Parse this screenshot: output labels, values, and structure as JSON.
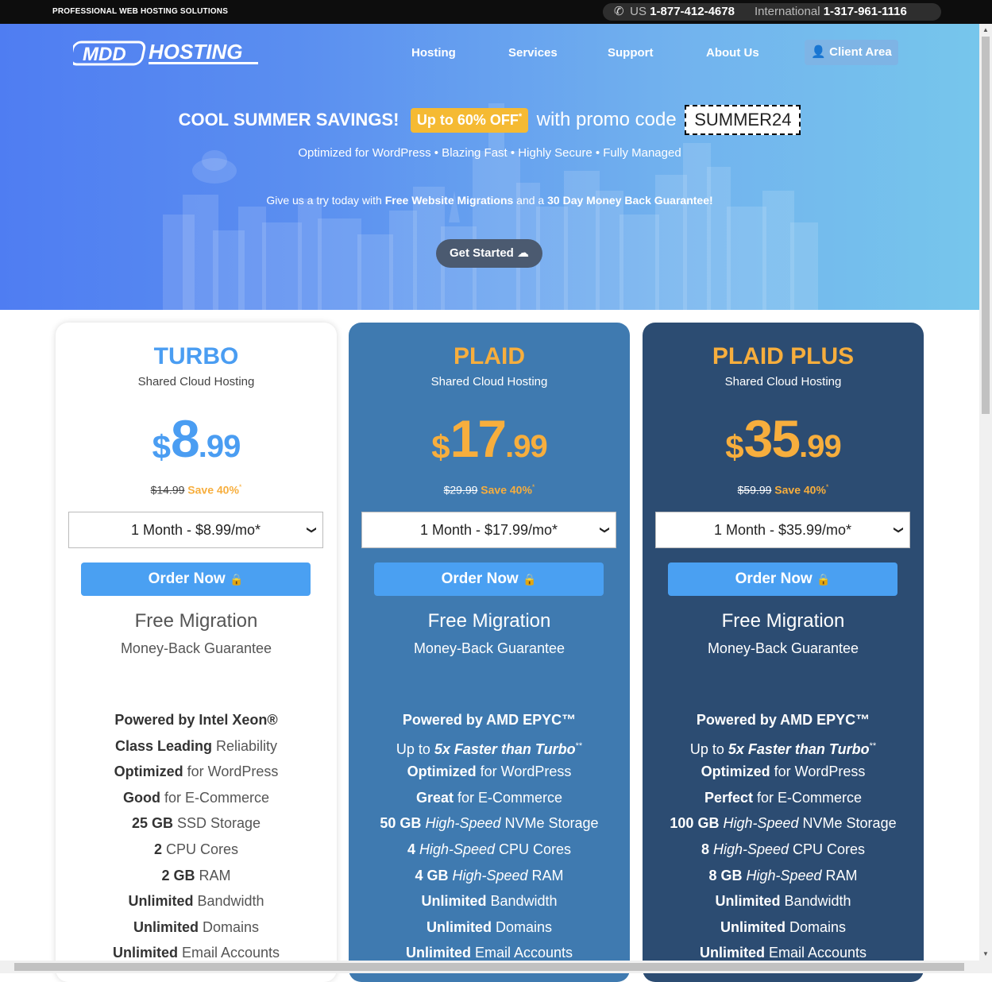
{
  "topbar": {
    "tagline": "PROFESSIONAL WEB HOSTING SOLUTIONS",
    "us_label": "US",
    "us_phone": "1-877-412-4678",
    "intl_label": "International",
    "intl_phone": "1-317-961-1116"
  },
  "nav": {
    "logo_text": "MDDHOSTING",
    "items": [
      "Hosting",
      "Services",
      "Support",
      "About Us"
    ],
    "client_area": "Client Area"
  },
  "hero": {
    "title": "COOL SUMMER SAVINGS!",
    "badge": "Up to 60% OFF",
    "badge_mark": "*",
    "with_promo": "with promo code",
    "promo_code": "SUMMER24",
    "subline": "Optimized for WordPress • Blazing Fast • Highly Secure • Fully Managed",
    "try_pre": "Give us a try today with ",
    "try_bold1": "Free Website Migrations",
    "try_mid": " and a ",
    "try_bold2": "30 Day Money Back Guarantee!",
    "cta": "Get Started"
  },
  "plans": [
    {
      "name": "TURBO",
      "type": "Shared Cloud Hosting",
      "currency": "$",
      "whole": "8",
      "cents": ".99",
      "old_price": "$14.99",
      "save": "Save 40%",
      "save_mark": "*",
      "term": "1 Month - $8.99/mo*",
      "order": "Order Now",
      "free_migration": "Free Migration",
      "money_back": "Money-Back Guarantee",
      "features": [
        {
          "bold": "Powered by Intel Xeon®",
          "italic": "",
          "rest": "",
          "sup": ""
        },
        {
          "bold": "Class Leading",
          "italic": "",
          "rest": " Reliability",
          "sup": ""
        },
        {
          "bold": "Optimized",
          "italic": "",
          "rest": " for WordPress",
          "sup": ""
        },
        {
          "bold": "Good",
          "italic": "",
          "rest": " for E-Commerce",
          "sup": ""
        },
        {
          "bold": "25 GB",
          "italic": "",
          "rest": " SSD Storage",
          "sup": ""
        },
        {
          "bold": "2",
          "italic": "",
          "rest": " CPU Cores",
          "sup": ""
        },
        {
          "bold": "2 GB",
          "italic": "",
          "rest": " RAM",
          "sup": ""
        },
        {
          "bold": "Unlimited",
          "italic": "",
          "rest": " Bandwidth",
          "sup": ""
        },
        {
          "bold": "Unlimited",
          "italic": "",
          "rest": " Domains",
          "sup": ""
        },
        {
          "bold": "Unlimited",
          "italic": "",
          "rest": " Email Accounts",
          "sup": ""
        }
      ]
    },
    {
      "name": "PLAID",
      "type": "Shared Cloud Hosting",
      "currency": "$",
      "whole": "17",
      "cents": ".99",
      "old_price": "$29.99",
      "save": "Save 40%",
      "save_mark": "*",
      "term": "1 Month - $17.99/mo*",
      "order": "Order Now",
      "free_migration": "Free Migration",
      "money_back": "Money-Back Guarantee",
      "features": [
        {
          "bold": "Powered by AMD EPYC™",
          "italic": "",
          "rest": "",
          "sup": ""
        },
        {
          "pre": "Up to ",
          "bold_italic": "5x Faster than Turbo",
          "sup": "**"
        },
        {
          "bold": "Optimized",
          "italic": "",
          "rest": " for WordPress",
          "sup": ""
        },
        {
          "bold": "Great",
          "italic": "",
          "rest": " for E-Commerce",
          "sup": ""
        },
        {
          "bold": "50 GB",
          "italic": " High-Speed",
          "rest": " NVMe Storage",
          "sup": ""
        },
        {
          "bold": "4",
          "italic": " High-Speed",
          "rest": " CPU Cores",
          "sup": ""
        },
        {
          "bold": "4 GB",
          "italic": " High-Speed",
          "rest": " RAM",
          "sup": ""
        },
        {
          "bold": "Unlimited",
          "italic": "",
          "rest": " Bandwidth",
          "sup": ""
        },
        {
          "bold": "Unlimited",
          "italic": "",
          "rest": " Domains",
          "sup": ""
        },
        {
          "bold": "Unlimited",
          "italic": "",
          "rest": " Email Accounts",
          "sup": ""
        }
      ]
    },
    {
      "name": "PLAID PLUS",
      "type": "Shared Cloud Hosting",
      "currency": "$",
      "whole": "35",
      "cents": ".99",
      "old_price": "$59.99",
      "save": "Save 40%",
      "save_mark": "*",
      "term": "1 Month - $35.99/mo*",
      "order": "Order Now",
      "free_migration": "Free Migration",
      "money_back": "Money-Back Guarantee",
      "features": [
        {
          "bold": "Powered by AMD EPYC™",
          "italic": "",
          "rest": "",
          "sup": ""
        },
        {
          "pre": "Up to ",
          "bold_italic": "5x Faster than Turbo",
          "sup": "**"
        },
        {
          "bold": "Optimized",
          "italic": "",
          "rest": " for WordPress",
          "sup": ""
        },
        {
          "bold": "Perfect",
          "italic": "",
          "rest": " for E-Commerce",
          "sup": ""
        },
        {
          "bold": "100 GB",
          "italic": " High-Speed",
          "rest": " NVMe Storage",
          "sup": ""
        },
        {
          "bold": "8",
          "italic": " High-Speed",
          "rest": " CPU Cores",
          "sup": ""
        },
        {
          "bold": "8 GB",
          "italic": " High-Speed",
          "rest": " RAM",
          "sup": ""
        },
        {
          "bold": "Unlimited",
          "italic": "",
          "rest": " Bandwidth",
          "sup": ""
        },
        {
          "bold": "Unlimited",
          "italic": "",
          "rest": " Domains",
          "sup": ""
        },
        {
          "bold": "Unlimited",
          "italic": "",
          "rest": " Email Accounts",
          "sup": ""
        }
      ]
    }
  ],
  "colors": {
    "accent_blue": "#4aa0f2",
    "accent_orange": "#f7ae3d",
    "plaid_card": "#3f7ab0",
    "plaid_plus_card": "#2c4c72",
    "promo_badge": "#f5ba33"
  }
}
